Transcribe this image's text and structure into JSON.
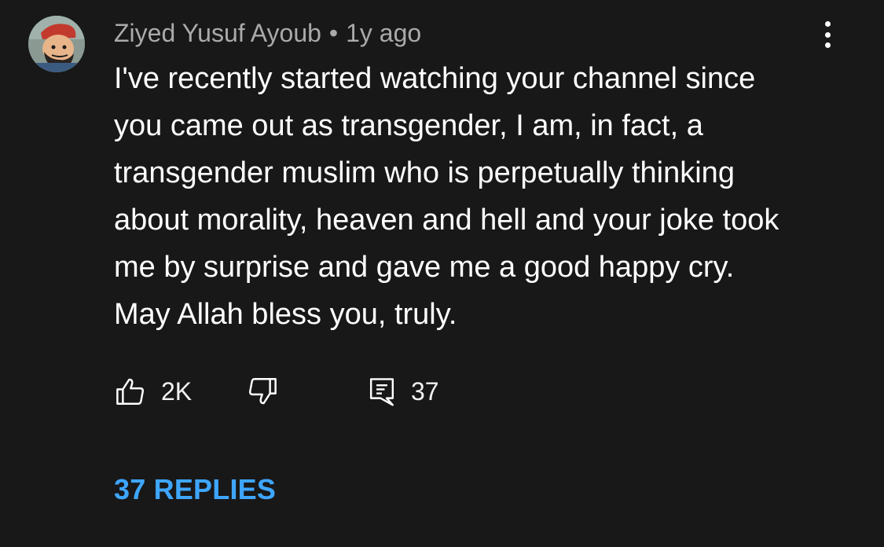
{
  "comment": {
    "author": "Ziyed Yusuf Ayoub",
    "separator": "•",
    "time": "1y ago",
    "text_lines": [
      "I've recently started watching your channel since",
      "you came out as transgender, I am, in fact, a",
      "transgender muslim who is perpetually thinking",
      "about morality, heaven and hell and your joke took",
      "me by surprise and gave me a good happy cry.",
      "May Allah bless you, truly."
    ],
    "actions": {
      "like_count": "2K",
      "reply_count": "37"
    },
    "replies_link": "37 REPLIES"
  },
  "icons": {
    "menu": "more-vert-icon",
    "like": "thumb-up-icon",
    "dislike": "thumb-down-icon",
    "reply": "comment-icon"
  },
  "colors": {
    "background": "#181818",
    "text": "#ffffff",
    "meta": "#aaaaaa",
    "link": "#3ea6ff"
  }
}
